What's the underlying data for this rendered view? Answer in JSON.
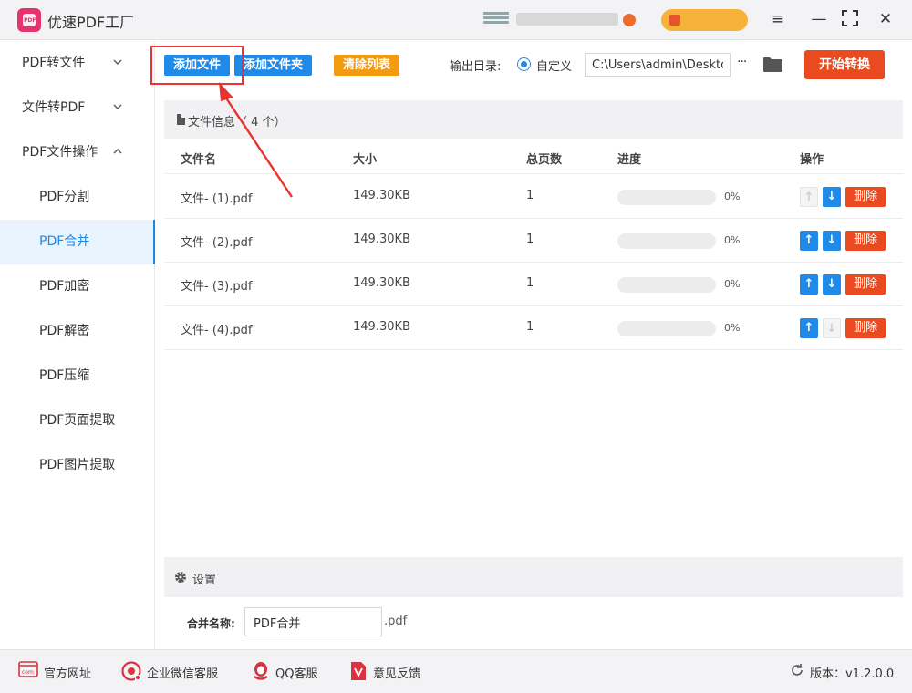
{
  "app": {
    "title": "优速PDF工厂",
    "logo_text": "PDF"
  },
  "window_controls": {
    "menu_icon": "hamburger-icon",
    "min_icon": "minimize-icon",
    "max_icon": "fullscreen-icon",
    "close_icon": "close-icon"
  },
  "sidebar": {
    "groups": [
      {
        "label": "PDF转文件",
        "chevron": "⌄"
      },
      {
        "label": "文件转PDF",
        "chevron": "⌄"
      },
      {
        "label": "PDF文件操作",
        "chevron": "⌃"
      }
    ],
    "items": [
      {
        "label": "PDF分割"
      },
      {
        "label": "PDF合并",
        "active": true
      },
      {
        "label": "PDF加密"
      },
      {
        "label": "PDF解密"
      },
      {
        "label": "PDF压缩"
      },
      {
        "label": "PDF页面提取"
      },
      {
        "label": "PDF图片提取"
      }
    ]
  },
  "toolbar": {
    "add_file": "添加文件",
    "add_folder": "添加文件夹",
    "clear_list": "清除列表",
    "output_label": "输出目录:",
    "radio_label": "自定义",
    "output_path": "C:\\Users\\admin\\Desktop",
    "more_label": "···",
    "start": "开始转换"
  },
  "file_panel": {
    "title": "文件信息（ 4 个）",
    "columns": [
      "文件名",
      "大小",
      "总页数",
      "进度",
      "操作"
    ],
    "delete_label": "删除",
    "rows": [
      {
        "name": "文件- (1).pdf",
        "size": "149.30KB",
        "pages": "1",
        "progress_value": 0,
        "progress": "0%",
        "up_enabled": false,
        "down_enabled": true
      },
      {
        "name": "文件- (2).pdf",
        "size": "149.30KB",
        "pages": "1",
        "progress_value": 0,
        "progress": "0%",
        "up_enabled": true,
        "down_enabled": true
      },
      {
        "name": "文件- (3).pdf",
        "size": "149.30KB",
        "pages": "1",
        "progress_value": 0,
        "progress": "0%",
        "up_enabled": true,
        "down_enabled": true
      },
      {
        "name": "文件- (4).pdf",
        "size": "149.30KB",
        "pages": "1",
        "progress_value": 0,
        "progress": "0%",
        "up_enabled": true,
        "down_enabled": false
      }
    ]
  },
  "settings": {
    "title": "设置",
    "merge_label": "合并名称:",
    "merge_value": "PDF合并",
    "merge_ext": ".pdf"
  },
  "footer": {
    "website": "官方网址",
    "wechat": "企业微信客服",
    "qq": "QQ客服",
    "feedback": "意见反馈",
    "version": "版本：v1.2.0.0"
  },
  "colors": {
    "accent": "#1f8ae8",
    "danger": "#ea4a1f",
    "warning": "#f29a10",
    "highlight": "#e8332f"
  }
}
